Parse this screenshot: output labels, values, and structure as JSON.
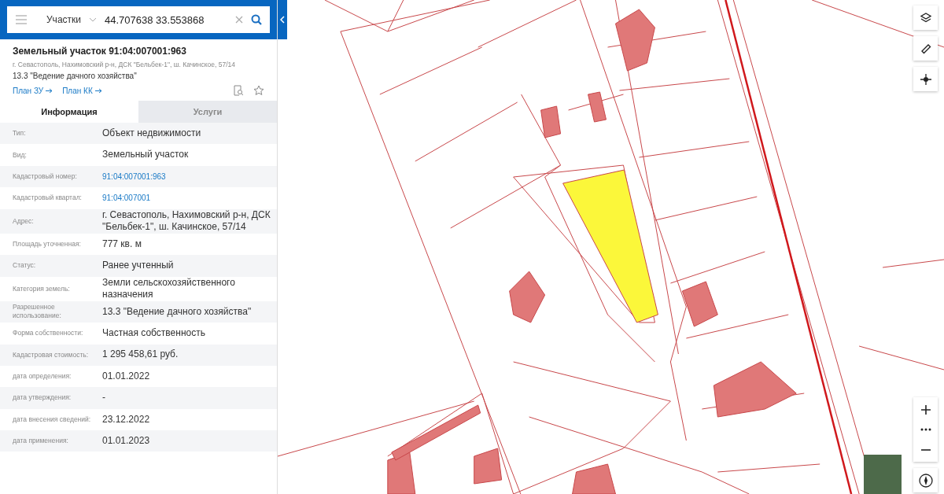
{
  "search": {
    "layer": "Участки",
    "value": "44.707638 33.553868"
  },
  "card": {
    "title": "Земельный участок 91:04:007001:963",
    "address": "г. Севастополь, Нахимовский р-н, ДСК \"Бельбек-1\", ш. Качинское, 57/14",
    "usage": "13.3 \"Ведение дачного хозяйства\"",
    "links": [
      "План ЗУ",
      "План КК"
    ]
  },
  "tabs": [
    {
      "label": "Информация",
      "selected": true
    },
    {
      "label": "Услуги",
      "selected": false
    }
  ],
  "rows": [
    {
      "label": "Тип:",
      "value": "Объект недвижимости",
      "kind": "text"
    },
    {
      "label": "Вид:",
      "value": "Земельный участок",
      "kind": "text"
    },
    {
      "label": "Кадастровый номер:",
      "value": "91:04:007001:963",
      "kind": "link"
    },
    {
      "label": "Кадастровый квартал:",
      "value": "91:04:007001",
      "kind": "link"
    },
    {
      "label": "Адрес:",
      "value": "г. Севастополь, Нахимовский р-н, ДСК \"Бельбек-1\", ш. Качинское, 57/14",
      "kind": "text"
    },
    {
      "label": "Площадь уточненная:",
      "value": "777 кв. м",
      "kind": "text"
    },
    {
      "label": "Статус:",
      "value": "Ранее учтенный",
      "kind": "text"
    },
    {
      "label": "Категория земель:",
      "value": "Земли сельскохозяйственного назначения",
      "kind": "text"
    },
    {
      "label": "Разрешенное использование:",
      "value": "13.3 \"Ведение дачного хозяйства\"",
      "kind": "text"
    },
    {
      "label": "Форма собственности:",
      "value": "Частная собственность",
      "kind": "text"
    },
    {
      "label": "Кадастровая стоимость:",
      "value": "1 295 458,61 руб.",
      "kind": "text"
    },
    {
      "label": "дата определения:",
      "value": "01.01.2022",
      "kind": "text"
    },
    {
      "label": "дата утверждения:",
      "value": "-",
      "kind": "text"
    },
    {
      "label": "дата внесения сведений:",
      "value": "23.12.2022",
      "kind": "text"
    },
    {
      "label": "дата применения:",
      "value": "01.01.2023",
      "kind": "text"
    }
  ]
}
